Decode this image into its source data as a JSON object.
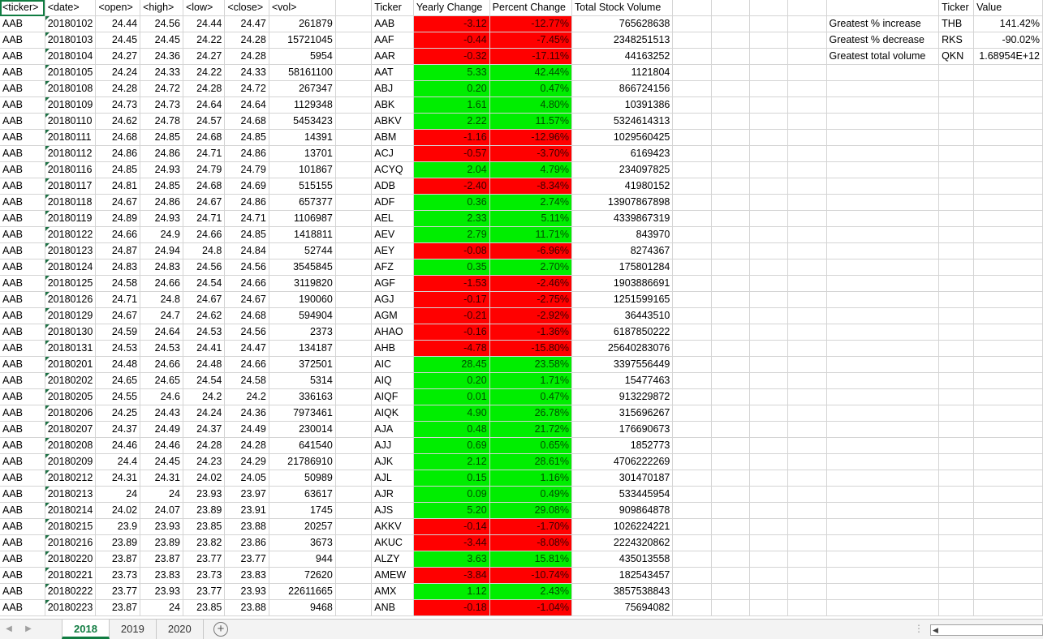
{
  "headers": [
    "<ticker>",
    "<date>",
    "<open>",
    "<high>",
    "<low>",
    "<close>",
    "<vol>",
    "",
    "Ticker",
    "Yearly Change",
    "Percent Change",
    "Total Stock Volume",
    "",
    "",
    "",
    "",
    "",
    "Ticker",
    "Value"
  ],
  "raw_rows": [
    [
      "AAB",
      "20180102",
      "24.44",
      "24.56",
      "24.44",
      "24.47",
      "261879"
    ],
    [
      "AAB",
      "20180103",
      "24.45",
      "24.45",
      "24.22",
      "24.28",
      "15721045"
    ],
    [
      "AAB",
      "20180104",
      "24.27",
      "24.36",
      "24.27",
      "24.28",
      "5954"
    ],
    [
      "AAB",
      "20180105",
      "24.24",
      "24.33",
      "24.22",
      "24.33",
      "58161100"
    ],
    [
      "AAB",
      "20180108",
      "24.28",
      "24.72",
      "24.28",
      "24.72",
      "267347"
    ],
    [
      "AAB",
      "20180109",
      "24.73",
      "24.73",
      "24.64",
      "24.64",
      "1129348"
    ],
    [
      "AAB",
      "20180110",
      "24.62",
      "24.78",
      "24.57",
      "24.68",
      "5453423"
    ],
    [
      "AAB",
      "20180111",
      "24.68",
      "24.85",
      "24.68",
      "24.85",
      "14391"
    ],
    [
      "AAB",
      "20180112",
      "24.86",
      "24.86",
      "24.71",
      "24.86",
      "13701"
    ],
    [
      "AAB",
      "20180116",
      "24.85",
      "24.93",
      "24.79",
      "24.79",
      "101867"
    ],
    [
      "AAB",
      "20180117",
      "24.81",
      "24.85",
      "24.68",
      "24.69",
      "515155"
    ],
    [
      "AAB",
      "20180118",
      "24.67",
      "24.86",
      "24.67",
      "24.86",
      "657377"
    ],
    [
      "AAB",
      "20180119",
      "24.89",
      "24.93",
      "24.71",
      "24.71",
      "1106987"
    ],
    [
      "AAB",
      "20180122",
      "24.66",
      "24.9",
      "24.66",
      "24.85",
      "1418811"
    ],
    [
      "AAB",
      "20180123",
      "24.87",
      "24.94",
      "24.8",
      "24.84",
      "52744"
    ],
    [
      "AAB",
      "20180124",
      "24.83",
      "24.83",
      "24.56",
      "24.56",
      "3545845"
    ],
    [
      "AAB",
      "20180125",
      "24.58",
      "24.66",
      "24.54",
      "24.66",
      "3119820"
    ],
    [
      "AAB",
      "20180126",
      "24.71",
      "24.8",
      "24.67",
      "24.67",
      "190060"
    ],
    [
      "AAB",
      "20180129",
      "24.67",
      "24.7",
      "24.62",
      "24.68",
      "594904"
    ],
    [
      "AAB",
      "20180130",
      "24.59",
      "24.64",
      "24.53",
      "24.56",
      "2373"
    ],
    [
      "AAB",
      "20180131",
      "24.53",
      "24.53",
      "24.41",
      "24.47",
      "134187"
    ],
    [
      "AAB",
      "20180201",
      "24.48",
      "24.66",
      "24.48",
      "24.66",
      "372501"
    ],
    [
      "AAB",
      "20180202",
      "24.65",
      "24.65",
      "24.54",
      "24.58",
      "5314"
    ],
    [
      "AAB",
      "20180205",
      "24.55",
      "24.6",
      "24.2",
      "24.2",
      "336163"
    ],
    [
      "AAB",
      "20180206",
      "24.25",
      "24.43",
      "24.24",
      "24.36",
      "7973461"
    ],
    [
      "AAB",
      "20180207",
      "24.37",
      "24.49",
      "24.37",
      "24.49",
      "230014"
    ],
    [
      "AAB",
      "20180208",
      "24.46",
      "24.46",
      "24.28",
      "24.28",
      "641540"
    ],
    [
      "AAB",
      "20180209",
      "24.4",
      "24.45",
      "24.23",
      "24.29",
      "21786910"
    ],
    [
      "AAB",
      "20180212",
      "24.31",
      "24.31",
      "24.02",
      "24.05",
      "50989"
    ],
    [
      "AAB",
      "20180213",
      "24",
      "24",
      "23.93",
      "23.97",
      "63617"
    ],
    [
      "AAB",
      "20180214",
      "24.02",
      "24.07",
      "23.89",
      "23.91",
      "1745"
    ],
    [
      "AAB",
      "20180215",
      "23.9",
      "23.93",
      "23.85",
      "23.88",
      "20257"
    ],
    [
      "AAB",
      "20180216",
      "23.89",
      "23.89",
      "23.82",
      "23.86",
      "3673"
    ],
    [
      "AAB",
      "20180220",
      "23.87",
      "23.87",
      "23.77",
      "23.77",
      "944"
    ],
    [
      "AAB",
      "20180221",
      "23.73",
      "23.83",
      "23.73",
      "23.83",
      "72620"
    ],
    [
      "AAB",
      "20180222",
      "23.77",
      "23.93",
      "23.77",
      "23.93",
      "22611665"
    ],
    [
      "AAB",
      "20180223",
      "23.87",
      "24",
      "23.85",
      "23.88",
      "9468"
    ]
  ],
  "summary_rows": [
    [
      "AAB",
      "-3.12",
      "-12.77%",
      "765628638",
      "red"
    ],
    [
      "AAF",
      "-0.44",
      "-7.45%",
      "2348251513",
      "red"
    ],
    [
      "AAR",
      "-0.32",
      "-17.11%",
      "44163252",
      "red"
    ],
    [
      "AAT",
      "5.33",
      "42.44%",
      "1121804",
      "green"
    ],
    [
      "ABJ",
      "0.20",
      "0.47%",
      "866724156",
      "green"
    ],
    [
      "ABK",
      "1.61",
      "4.80%",
      "10391386",
      "green"
    ],
    [
      "ABKV",
      "2.22",
      "11.57%",
      "5324614313",
      "green"
    ],
    [
      "ABM",
      "-1.16",
      "-12.96%",
      "1029560425",
      "red"
    ],
    [
      "ACJ",
      "-0.57",
      "-3.70%",
      "6169423",
      "red"
    ],
    [
      "ACYQ",
      "2.04",
      "4.79%",
      "234097825",
      "green"
    ],
    [
      "ADB",
      "-2.40",
      "-8.34%",
      "41980152",
      "red"
    ],
    [
      "ADF",
      "0.36",
      "2.74%",
      "13907867898",
      "green"
    ],
    [
      "AEL",
      "2.33",
      "5.11%",
      "4339867319",
      "green"
    ],
    [
      "AEV",
      "2.79",
      "11.71%",
      "843970",
      "green"
    ],
    [
      "AEY",
      "-0.08",
      "-6.96%",
      "8274367",
      "red"
    ],
    [
      "AFZ",
      "0.35",
      "2.70%",
      "175801284",
      "green"
    ],
    [
      "AGF",
      "-1.53",
      "-2.46%",
      "1903886691",
      "red"
    ],
    [
      "AGJ",
      "-0.17",
      "-2.75%",
      "1251599165",
      "red"
    ],
    [
      "AGM",
      "-0.21",
      "-2.92%",
      "36443510",
      "red"
    ],
    [
      "AHAO",
      "-0.16",
      "-1.36%",
      "6187850222",
      "red"
    ],
    [
      "AHB",
      "-4.78",
      "-15.80%",
      "25640283076",
      "red"
    ],
    [
      "AIC",
      "28.45",
      "23.58%",
      "3397556449",
      "green"
    ],
    [
      "AIQ",
      "0.20",
      "1.71%",
      "15477463",
      "green"
    ],
    [
      "AIQF",
      "0.01",
      "0.47%",
      "913229872",
      "green"
    ],
    [
      "AIQK",
      "4.90",
      "26.78%",
      "315696267",
      "green"
    ],
    [
      "AJA",
      "0.48",
      "21.72%",
      "176690673",
      "green"
    ],
    [
      "AJJ",
      "0.69",
      "0.65%",
      "1852773",
      "green"
    ],
    [
      "AJK",
      "2.12",
      "28.61%",
      "4706222269",
      "green"
    ],
    [
      "AJL",
      "0.15",
      "1.16%",
      "301470187",
      "green"
    ],
    [
      "AJR",
      "0.09",
      "0.49%",
      "533445954",
      "green"
    ],
    [
      "AJS",
      "5.20",
      "29.08%",
      "909864878",
      "green"
    ],
    [
      "AKKV",
      "-0.14",
      "-1.70%",
      "1026224221",
      "red"
    ],
    [
      "AKUC",
      "-3.44",
      "-8.08%",
      "2224320862",
      "red"
    ],
    [
      "ALZY",
      "3.63",
      "15.81%",
      "435013558",
      "green"
    ],
    [
      "AMEW",
      "-3.84",
      "-10.74%",
      "182543457",
      "red"
    ],
    [
      "AMX",
      "1.12",
      "2.43%",
      "3857538843",
      "green"
    ],
    [
      "ANB",
      "-0.18",
      "-1.04%",
      "75694082",
      "red"
    ]
  ],
  "greatest": [
    {
      "label": "Greatest % increase",
      "ticker": "THB",
      "value": "141.42%"
    },
    {
      "label": "Greatest % decrease",
      "ticker": "RKS",
      "value": "-90.02%"
    },
    {
      "label": "Greatest total volume",
      "ticker": "QKN",
      "value": "1.68954E+12"
    }
  ],
  "colors": {
    "positive": "#00ee00",
    "negative": "#ff0000",
    "accent": "#107c41"
  },
  "sheet_tabs": [
    "2018",
    "2019",
    "2020"
  ],
  "active_tab": "2018",
  "icons": {
    "add_sheet": "plus-circle-icon",
    "scroll_left": "scroll-left-icon",
    "scroll_right": "scroll-right-icon"
  }
}
